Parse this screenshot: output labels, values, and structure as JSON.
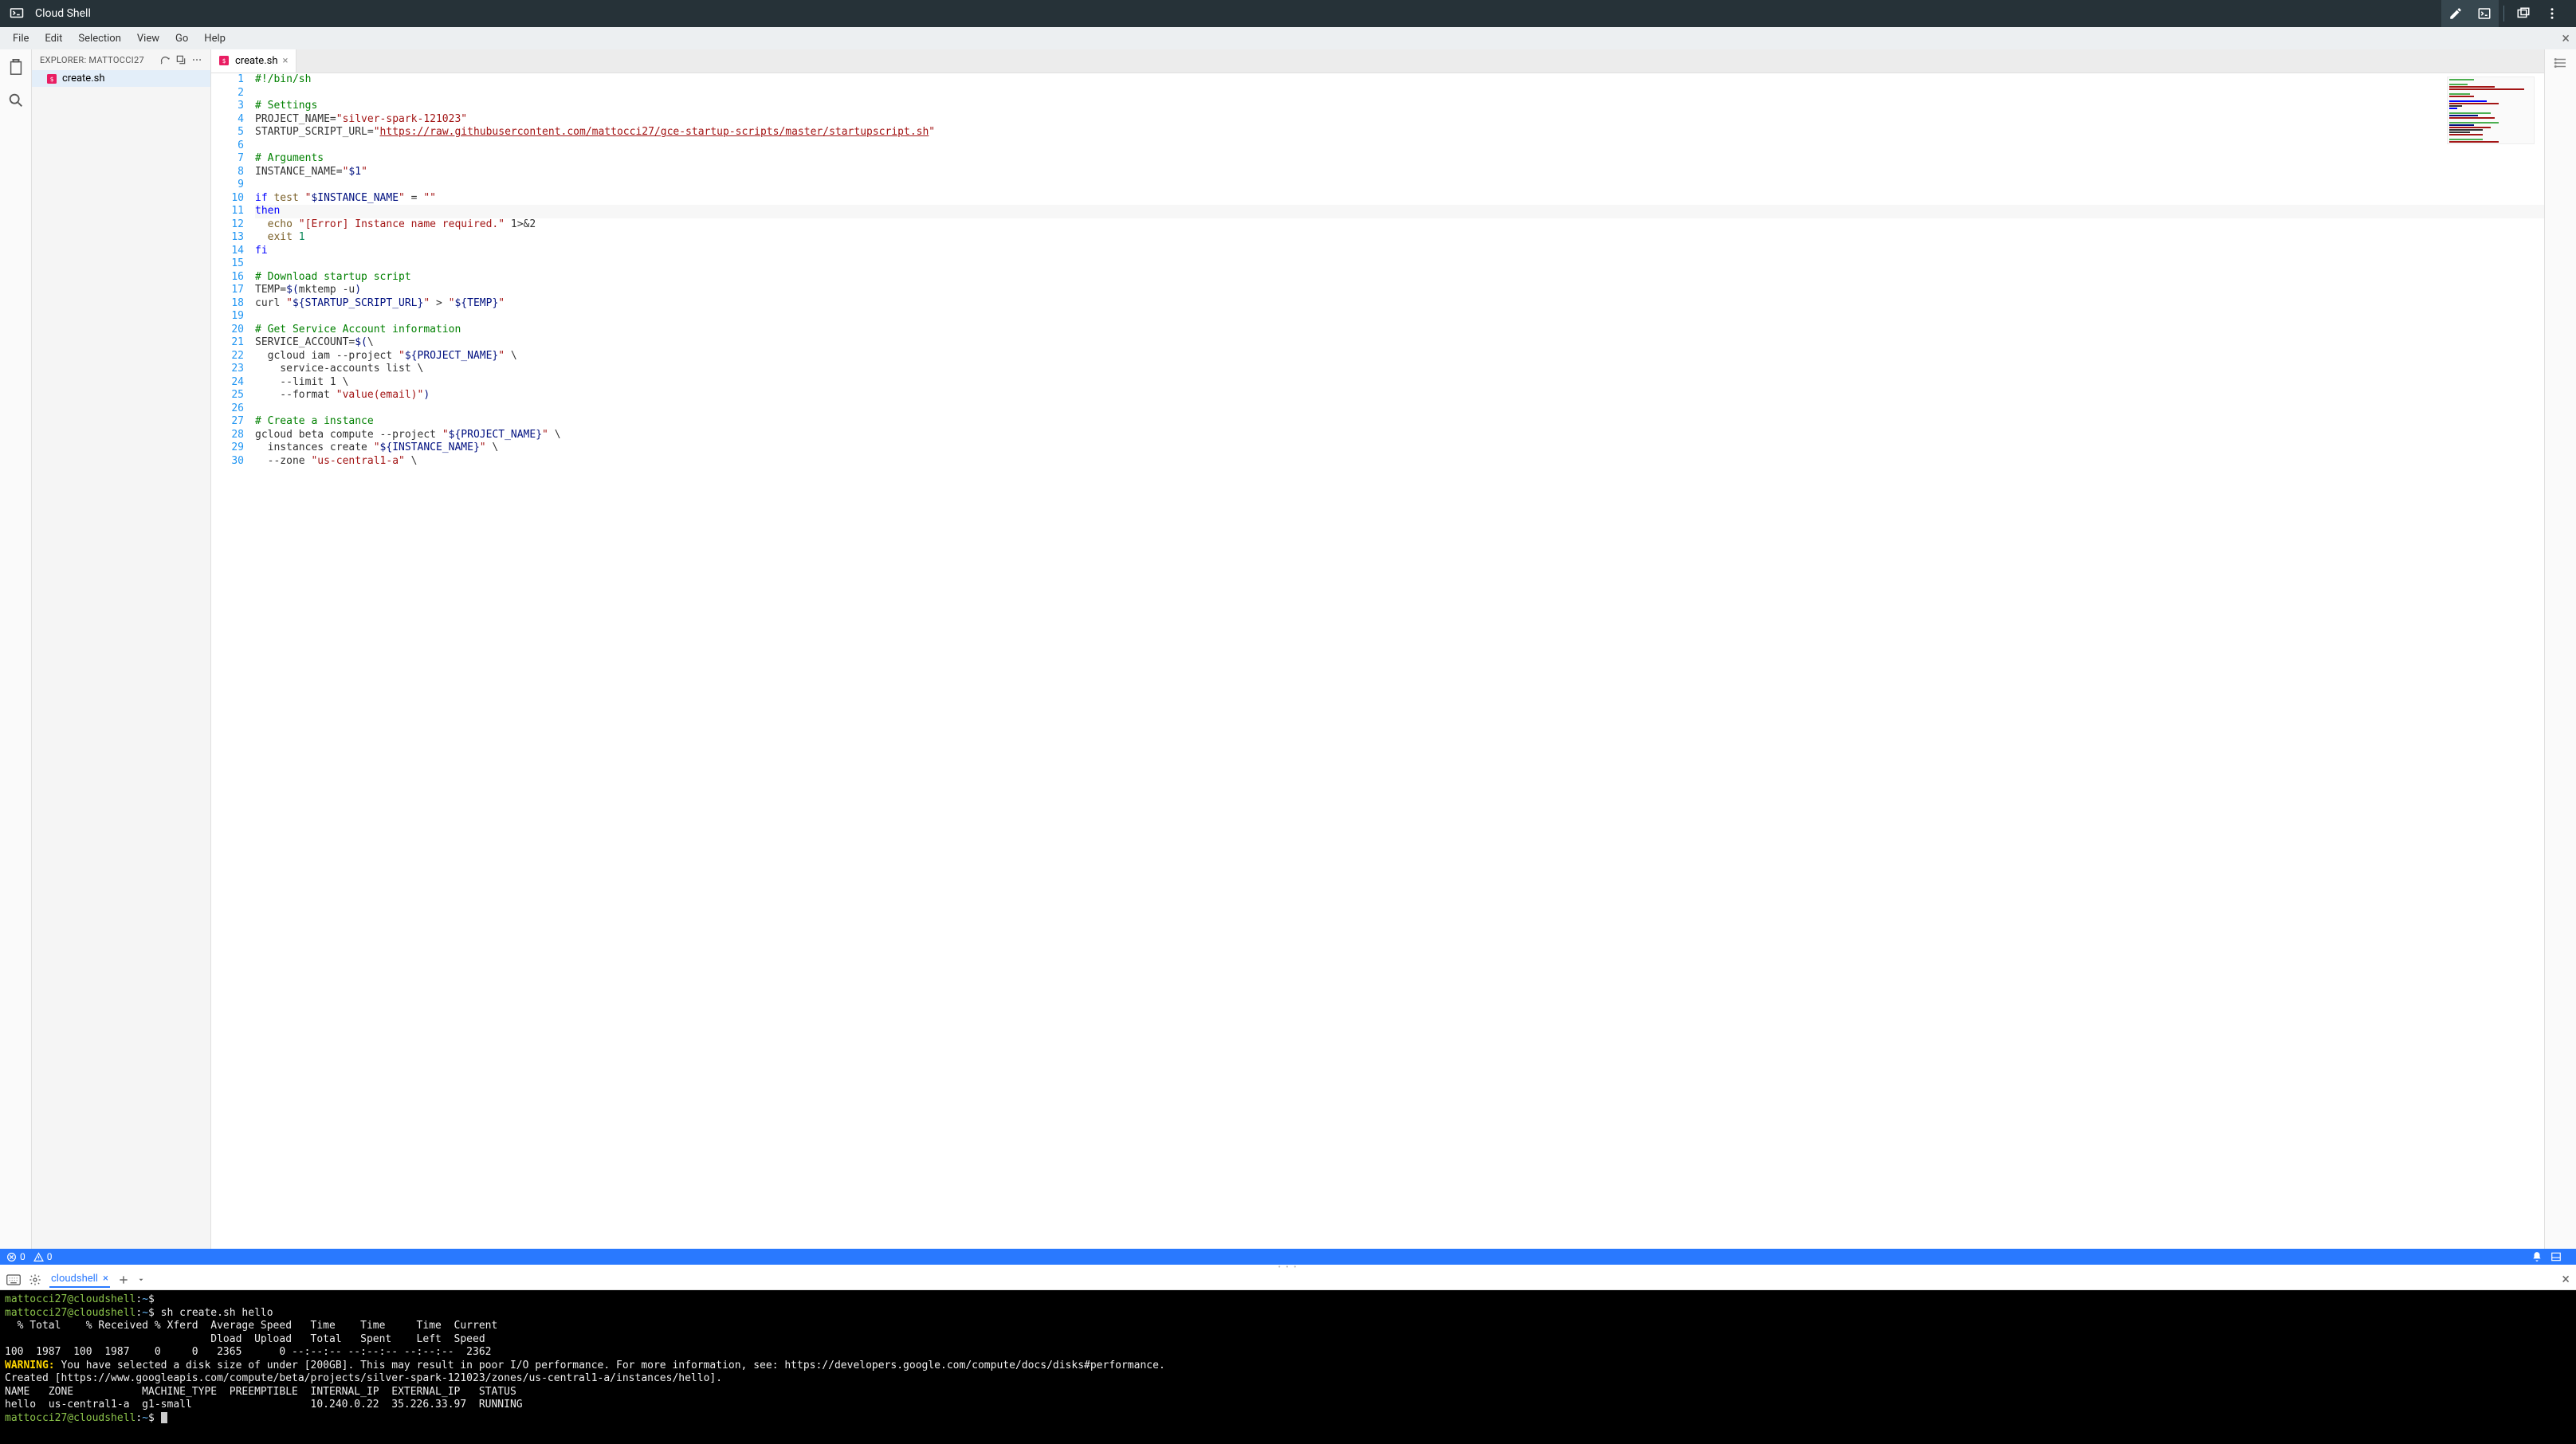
{
  "titlebar": {
    "title": "Cloud Shell"
  },
  "menubar": {
    "items": [
      "File",
      "Edit",
      "Selection",
      "View",
      "Go",
      "Help"
    ]
  },
  "explorer": {
    "label": "EXPLORER: MATTOCCI27",
    "file": "create.sh"
  },
  "tab": {
    "name": "create.sh"
  },
  "code": {
    "lines": [
      {
        "n": 1,
        "cls": "",
        "html": "<span class='c-comment'>#!/bin/sh</span>"
      },
      {
        "n": 2,
        "cls": "",
        "html": ""
      },
      {
        "n": 3,
        "cls": "",
        "html": "<span class='c-comment'># Settings</span>"
      },
      {
        "n": 4,
        "cls": "",
        "html": "PROJECT_NAME=<span class='c-string'>\"silver-spark-121023\"</span>"
      },
      {
        "n": 5,
        "cls": "",
        "html": "STARTUP_SCRIPT_URL=<span class='c-string'>\"</span><span class='c-url'>https://raw.githubusercontent.com/mattocci27/gce-startup-scripts/master/startupscript.sh</span><span class='c-string'>\"</span>"
      },
      {
        "n": 6,
        "cls": "",
        "html": ""
      },
      {
        "n": 7,
        "cls": "",
        "html": "<span class='c-comment'># Arguments</span>"
      },
      {
        "n": 8,
        "cls": "",
        "html": "INSTANCE_NAME=<span class='c-string'>\"<span class='c-var'>$1</span>\"</span>"
      },
      {
        "n": 9,
        "cls": "",
        "html": ""
      },
      {
        "n": 10,
        "cls": "",
        "html": "<span class='c-keyword'>if</span> <span class='c-fn'>test</span> <span class='c-string'>\"<span class='c-var'>$INSTANCE_NAME</span>\"</span> = <span class='c-string'>\"\"</span>"
      },
      {
        "n": 11,
        "cls": "hl-line",
        "html": "<span class='c-keyword'>then</span>"
      },
      {
        "n": 12,
        "cls": "",
        "html": "  <span class='c-fn'>echo</span> <span class='c-string'>\"[Error] Instance name required.\"</span> 1&gt;&amp;2"
      },
      {
        "n": 13,
        "cls": "",
        "html": "  <span class='c-fn'>exit</span> <span class='c-num'>1</span>"
      },
      {
        "n": 14,
        "cls": "",
        "html": "<span class='c-keyword'>fi</span>"
      },
      {
        "n": 15,
        "cls": "",
        "html": ""
      },
      {
        "n": 16,
        "cls": "",
        "html": "<span class='c-comment'># Download startup script</span>"
      },
      {
        "n": 17,
        "cls": "",
        "html": "TEMP=<span class='c-var'>$(</span>mktemp -u<span class='c-var'>)</span>"
      },
      {
        "n": 18,
        "cls": "",
        "html": "curl <span class='c-string'>\"<span class='c-var'>${STARTUP_SCRIPT_URL}</span>\"</span> &gt; <span class='c-string'>\"<span class='c-var'>${TEMP}</span>\"</span>"
      },
      {
        "n": 19,
        "cls": "",
        "html": ""
      },
      {
        "n": 20,
        "cls": "",
        "html": "<span class='c-comment'># Get Service Account information</span>"
      },
      {
        "n": 21,
        "cls": "",
        "html": "SERVICE_ACCOUNT=<span class='c-var'>$(</span>\\"
      },
      {
        "n": 22,
        "cls": "",
        "html": "  gcloud iam --project <span class='c-string'>\"<span class='c-var'>${PROJECT_NAME}</span>\"</span> \\"
      },
      {
        "n": 23,
        "cls": "",
        "html": "    service-accounts list \\"
      },
      {
        "n": 24,
        "cls": "",
        "html": "    --limit 1 \\"
      },
      {
        "n": 25,
        "cls": "",
        "html": "    --format <span class='c-string'>\"value(email)\"</span><span class='c-var'>)</span>"
      },
      {
        "n": 26,
        "cls": "",
        "html": ""
      },
      {
        "n": 27,
        "cls": "",
        "html": "<span class='c-comment'># Create a instance</span>"
      },
      {
        "n": 28,
        "cls": "",
        "html": "gcloud beta compute --project <span class='c-string'>\"<span class='c-var'>${PROJECT_NAME}</span>\"</span> \\"
      },
      {
        "n": 29,
        "cls": "",
        "html": "  instances create <span class='c-string'>\"<span class='c-var'>${INSTANCE_NAME}</span>\"</span> \\"
      },
      {
        "n": 30,
        "cls": "",
        "html": "  --zone <span class='c-string'>\"us-central1-a\"</span> \\"
      }
    ]
  },
  "statusbar": {
    "errors": "0",
    "warnings": "0"
  },
  "terminal_tab": {
    "name": "cloudshell"
  },
  "terminal": {
    "lines": [
      "<span class='prompt'>mattocci27@cloudshell</span>:<span style='color:#64b5f6'>~</span>$",
      "<span class='prompt'>mattocci27@cloudshell</span>:<span style='color:#64b5f6'>~</span>$ sh create.sh hello",
      "  % Total    % Received % Xferd  Average Speed   Time    Time     Time  Current",
      "                                 Dload  Upload   Total   Spent    Left  Speed",
      "100  1987  100  1987    0     0   2365      0 --:--:-- --:--:-- --:--:--  2362",
      "<span class='warn'>WARNING:</span> You have selected a disk size of under [200GB]. This may result in poor I/O performance. For more information, see: https://developers.google.com/compute/docs/disks#performance.",
      "Created [https://www.googleapis.com/compute/beta/projects/silver-spark-121023/zones/us-central1-a/instances/hello].",
      "NAME   ZONE           MACHINE_TYPE  PREEMPTIBLE  INTERNAL_IP  EXTERNAL_IP   STATUS",
      "hello  us-central1-a  g1-small                   10.240.0.22  35.226.33.97  RUNNING",
      "<span class='prompt'>mattocci27@cloudshell</span>:<span style='color:#64b5f6'>~</span>$ <span class='cursor'></span>"
    ]
  }
}
